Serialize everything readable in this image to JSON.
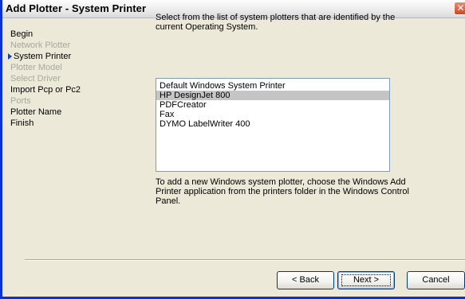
{
  "window": {
    "title": "Add Plotter - System Printer",
    "close_glyph": "✕"
  },
  "steps": [
    {
      "label": "Begin",
      "state": "enabled"
    },
    {
      "label": "Network Plotter",
      "state": "disabled"
    },
    {
      "label": "System Printer",
      "state": "current"
    },
    {
      "label": "Plotter Model",
      "state": "disabled"
    },
    {
      "label": "Select Driver",
      "state": "disabled"
    },
    {
      "label": "Import Pcp or Pc2",
      "state": "enabled"
    },
    {
      "label": "Ports",
      "state": "disabled"
    },
    {
      "label": "Plotter Name",
      "state": "enabled"
    },
    {
      "label": "Finish",
      "state": "enabled"
    }
  ],
  "content": {
    "description": "Select from the list of system plotters that are identified by the current Operating System.",
    "printers": [
      "Default Windows System Printer",
      "HP DesignJet 800",
      "PDFCreator",
      "Fax",
      "DYMO LabelWriter 400"
    ],
    "selected_printer": "HP DesignJet 800",
    "info": "To add a new Windows system plotter, choose the Windows Add Printer application from the printers folder in the Windows Control Panel."
  },
  "buttons": {
    "back": "< Back",
    "next": "Next >",
    "cancel": "Cancel"
  },
  "colors": {
    "window_border": "#0831d9",
    "disabled_text": "#a8a8a0",
    "selection": "#c5c5c5",
    "current_step_arrow": "#1a3fb6"
  }
}
